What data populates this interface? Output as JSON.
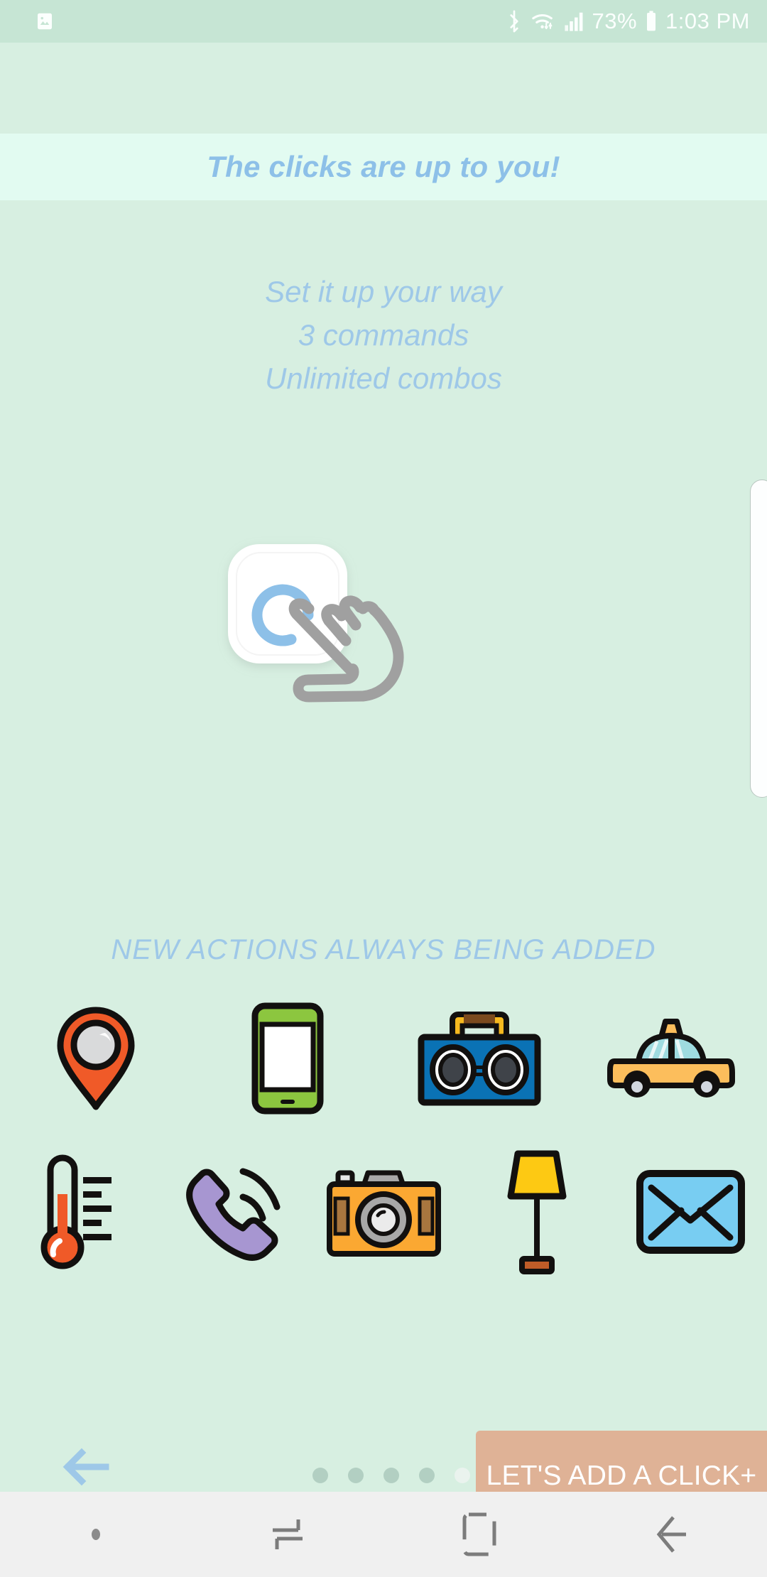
{
  "status_bar": {
    "left_icon": "image-icon",
    "bluetooth_icon": "bluetooth-icon",
    "wifi_icon": "wifi-icon",
    "signal_icon": "signal-bars-icon",
    "battery_percent": "73%",
    "battery_icon": "battery-icon",
    "time": "1:03 PM",
    "background_color": "#c6e5d4",
    "text_color": "#fbfffd"
  },
  "banner": {
    "title": "The clicks are up to you!",
    "background_color": "#e2fbf1",
    "text_color": "#8dc0e8"
  },
  "subtitle": {
    "line1": "Set it up your way",
    "line2": "3 commands",
    "line3": "Unlimited combos",
    "text_color": "#9ec8e8"
  },
  "illustration": {
    "name": "tap-gesture-illustration",
    "card_color": "#ffffff",
    "arc_color": "#8dc0e8",
    "hand_color": "#a0a0a0"
  },
  "actions_section": {
    "heading": "NEW ACTIONS ALWAYS BEING ADDED",
    "heading_color": "#9ec8e8",
    "icons": [
      [
        {
          "name": "location-pin-icon",
          "label": "Location",
          "color": "#f05a28"
        },
        {
          "name": "smartphone-icon",
          "label": "Phone screen",
          "color": "#8cc63f"
        },
        {
          "name": "boombox-icon",
          "label": "Music",
          "color": "#0a72b5"
        },
        {
          "name": "taxi-icon",
          "label": "Taxi",
          "color": "#fcbe5c"
        }
      ],
      [
        {
          "name": "thermometer-icon",
          "label": "Temperature",
          "color": "#f05a28"
        },
        {
          "name": "phone-call-icon",
          "label": "Call",
          "color": "#a796d1"
        },
        {
          "name": "camera-icon",
          "label": "Camera",
          "color": "#fba832"
        },
        {
          "name": "lamp-icon",
          "label": "Light",
          "color": "#fdc913"
        },
        {
          "name": "envelope-icon",
          "label": "Mail",
          "color": "#78cdf2"
        }
      ]
    ]
  },
  "footer": {
    "back_arrow_icon": "arrow-left-icon",
    "back_arrow_color": "#9ec8e8",
    "pager": {
      "total": 5,
      "active_index": 4,
      "dot_color": "#b2cfc2",
      "active_dot_color": "#eaf3ee"
    },
    "cta_label": "LET'S ADD A CLICK+",
    "cta_background_color": "#dfb296",
    "cta_text_color": "#ffffff"
  },
  "nav_bar": {
    "background_color": "#f0f0f0",
    "items": [
      {
        "name": "menu-dot-icon",
        "label": "Menu"
      },
      {
        "name": "recents-icon",
        "label": "Recents"
      },
      {
        "name": "home-icon",
        "label": "Home"
      },
      {
        "name": "back-icon",
        "label": "Back"
      }
    ]
  },
  "page": {
    "background_color": "#d7efe1"
  }
}
